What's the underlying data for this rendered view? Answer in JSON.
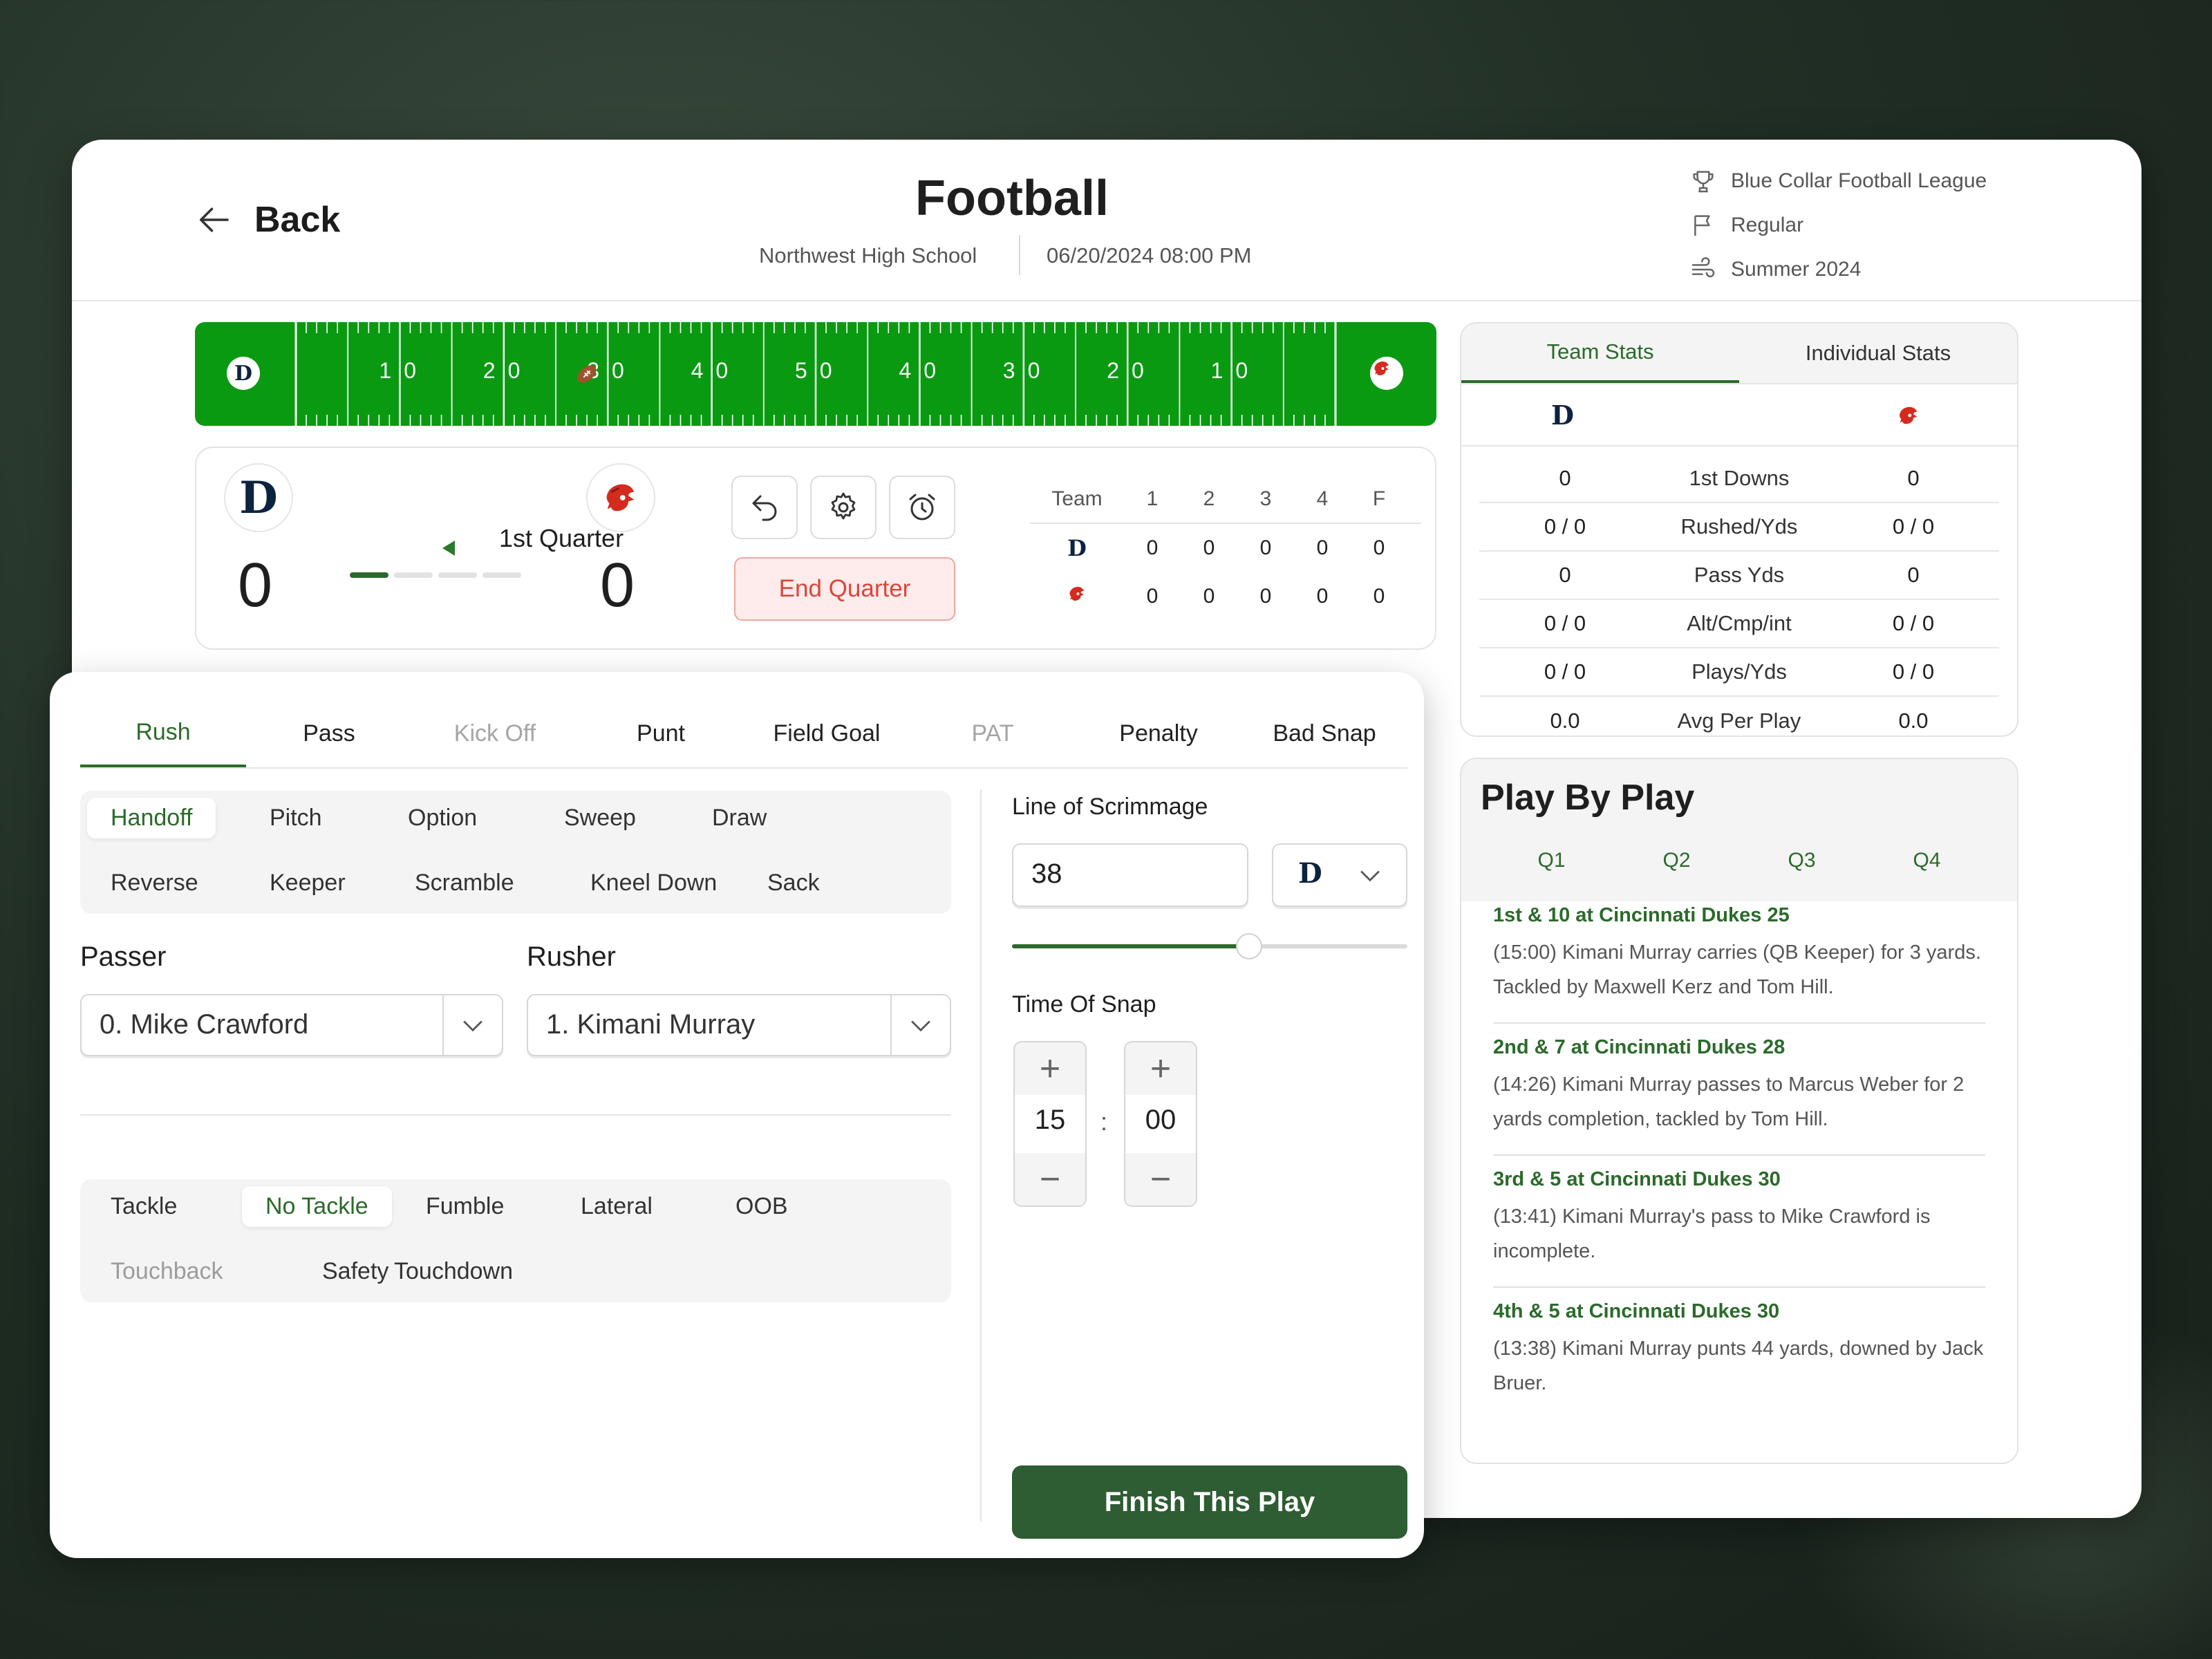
{
  "header": {
    "back_label": "Back",
    "title": "Football",
    "location": "Northwest High School",
    "datetime": "06/20/2024 08:00 PM",
    "league": "Blue Collar Football League",
    "season_type": "Regular",
    "season": "Summer 2024"
  },
  "field": {
    "yard_labels": [
      "10",
      "20",
      "30",
      "40",
      "50",
      "40",
      "30",
      "20",
      "10"
    ],
    "ball_position_yards": 28,
    "home_logo_letter": "D",
    "colors": {
      "turf": "#0a9a12",
      "lines": "#ffffff"
    }
  },
  "scoreboard": {
    "home_logo_letter": "D",
    "home_score": "0",
    "away_score": "0",
    "quarter_label": "1st Quarter",
    "quarter_progress_current": 1,
    "quarter_progress_total": 4,
    "end_quarter_label": "End Quarter",
    "table": {
      "headers": [
        "Team",
        "1",
        "2",
        "3",
        "4",
        "F"
      ],
      "home_logo_letter": "D",
      "home": [
        "0",
        "0",
        "0",
        "0",
        "0"
      ],
      "away": [
        "0",
        "0",
        "0",
        "0",
        "0"
      ]
    }
  },
  "stats": {
    "tabs": [
      "Team Stats",
      "Individual Stats"
    ],
    "home_logo_letter": "D",
    "rows": [
      {
        "home": "0",
        "label": "1st Downs",
        "away": "0"
      },
      {
        "home": "0 / 0",
        "label": "Rushed/Yds",
        "away": "0 / 0"
      },
      {
        "home": "0",
        "label": "Pass Yds",
        "away": "0"
      },
      {
        "home": "0 / 0",
        "label": "Alt/Cmp/int",
        "away": "0 / 0"
      },
      {
        "home": "0 / 0",
        "label": "Plays/Yds",
        "away": "0 / 0"
      },
      {
        "home": "0.0",
        "label": "Avg Per Play",
        "away": "0.0"
      }
    ]
  },
  "pbp": {
    "title": "Play By Play",
    "tabs": [
      "Q1",
      "Q2",
      "Q3",
      "Q4"
    ],
    "plays": [
      {
        "head": "1st & 10 at Cincinnati Dukes 25",
        "text": "(15:00) Kimani Murray carries (QB Keeper) for 3 yards. Tackled by Maxwell Kerz and Tom Hill."
      },
      {
        "head": "2nd & 7 at Cincinnati Dukes 28",
        "text": "(14:26) Kimani Murray passes to Marcus Weber for 2 yards completion, tackled by Tom Hill."
      },
      {
        "head": "3rd & 5 at Cincinnati Dukes 30",
        "text": "(13:41) Kimani Murray's pass to Mike Crawford is incomplete."
      },
      {
        "head": "4th & 5 at Cincinnati Dukes 30",
        "text": "(13:38) Kimani Murray punts 44 yards, downed by Jack Bruer."
      }
    ]
  },
  "play_entry": {
    "tabs": [
      "Rush",
      "Pass",
      "Kick Off",
      "Punt",
      "Field Goal",
      "PAT",
      "Penalty",
      "Bad Snap"
    ],
    "play_types_row1": [
      "Handoff",
      "Pitch",
      "Option",
      "Sweep",
      "Draw"
    ],
    "play_types_row2": [
      "Reverse",
      "Keeper",
      "Scramble",
      "Kneel Down",
      "Sack"
    ],
    "passer_label": "Passer",
    "passer_value": "0. Mike Crawford",
    "rusher_label": "Rusher",
    "rusher_value": "1. Kimani Murray",
    "results_row1": [
      "Tackle",
      "No Tackle",
      "Fumble",
      "Lateral",
      "OOB"
    ],
    "results_row2": [
      "Touchback",
      "Safety",
      "Touchdown"
    ],
    "los_label": "Line of Scrimmage",
    "los_value": "38",
    "los_team_letter": "D",
    "los_slider_fraction": 0.6,
    "snap_label": "Time Of Snap",
    "snap_minutes": "15",
    "snap_seconds": "00",
    "colon": ":",
    "finish_label": "Finish This Play"
  }
}
